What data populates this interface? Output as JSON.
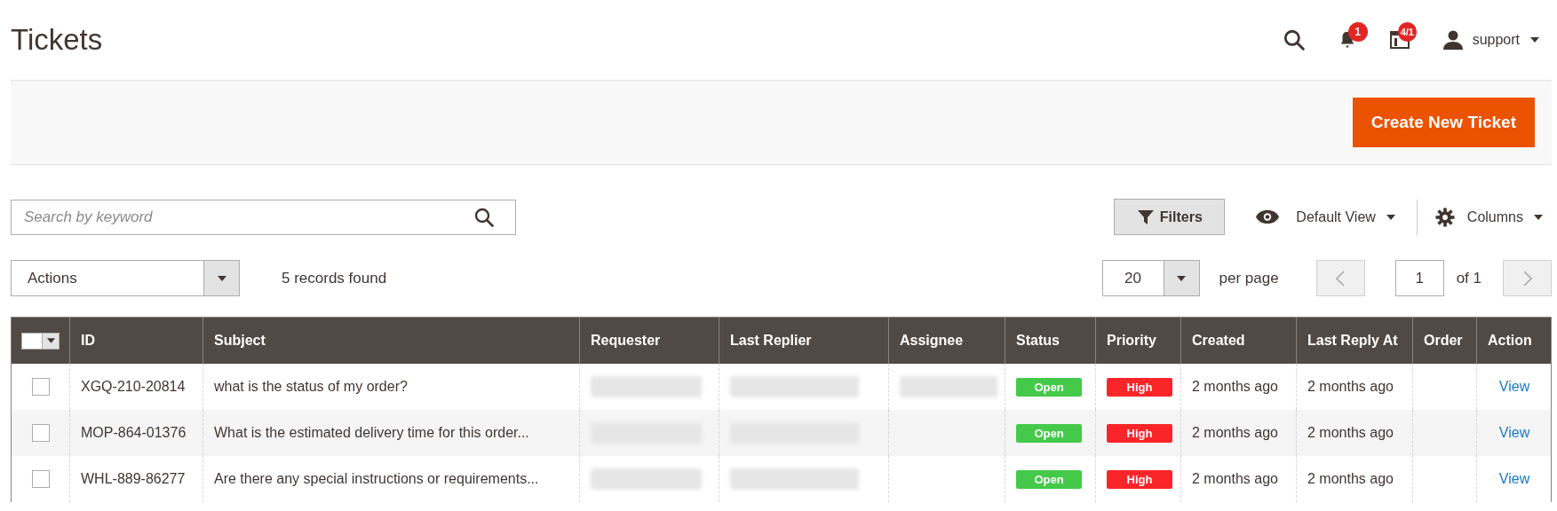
{
  "page_title": "Tickets",
  "header": {
    "notifications_badge": "1",
    "tasks_badge": "4/1",
    "user": "support"
  },
  "create_button": "Create New Ticket",
  "search": {
    "placeholder": "Search by keyword"
  },
  "filters_button": "Filters",
  "view_menu": "Default View",
  "columns_menu": "Columns",
  "actions_select": "Actions",
  "records_found": "5 records found",
  "per_page": {
    "value": "20",
    "label": "per page"
  },
  "pager": {
    "page": "1",
    "of": "of 1",
    "prev_disabled": true,
    "next_disabled": true
  },
  "table": {
    "columns": [
      "ID",
      "Subject",
      "Requester",
      "Last Replier",
      "Assignee",
      "Status",
      "Priority",
      "Created",
      "Last Reply At",
      "Order",
      "Action"
    ],
    "rows": [
      {
        "checked": false,
        "id": "XGQ-210-20814",
        "subject": "what is the status of my order?",
        "requester_redacted": true,
        "last_replier_redacted": true,
        "assignee_redacted": true,
        "status": {
          "label": "Open",
          "color": "#45c94a"
        },
        "priority": {
          "label": "High",
          "color": "#fa2529"
        },
        "created": "2 months ago",
        "last_reply_at": "2 months ago",
        "action": "View"
      },
      {
        "checked": false,
        "id": "MOP-864-01376",
        "subject": "What is the estimated delivery time for this order...",
        "requester_redacted": true,
        "last_replier_redacted": true,
        "assignee_redacted": false,
        "status": {
          "label": "Open",
          "color": "#45c94a"
        },
        "priority": {
          "label": "High",
          "color": "#fa2529"
        },
        "created": "2 months ago",
        "last_reply_at": "2 months ago",
        "action": "View"
      },
      {
        "checked": false,
        "id": "WHL-889-86277",
        "subject": "Are there any special instructions or requirements...",
        "requester_redacted": true,
        "last_replier_redacted": true,
        "assignee_redacted": false,
        "status": {
          "label": "Open",
          "color": "#45c94a"
        },
        "priority": {
          "label": "High",
          "color": "#fa2529"
        },
        "created": "2 months ago",
        "last_reply_at": "2 months ago",
        "action": "View"
      }
    ]
  }
}
